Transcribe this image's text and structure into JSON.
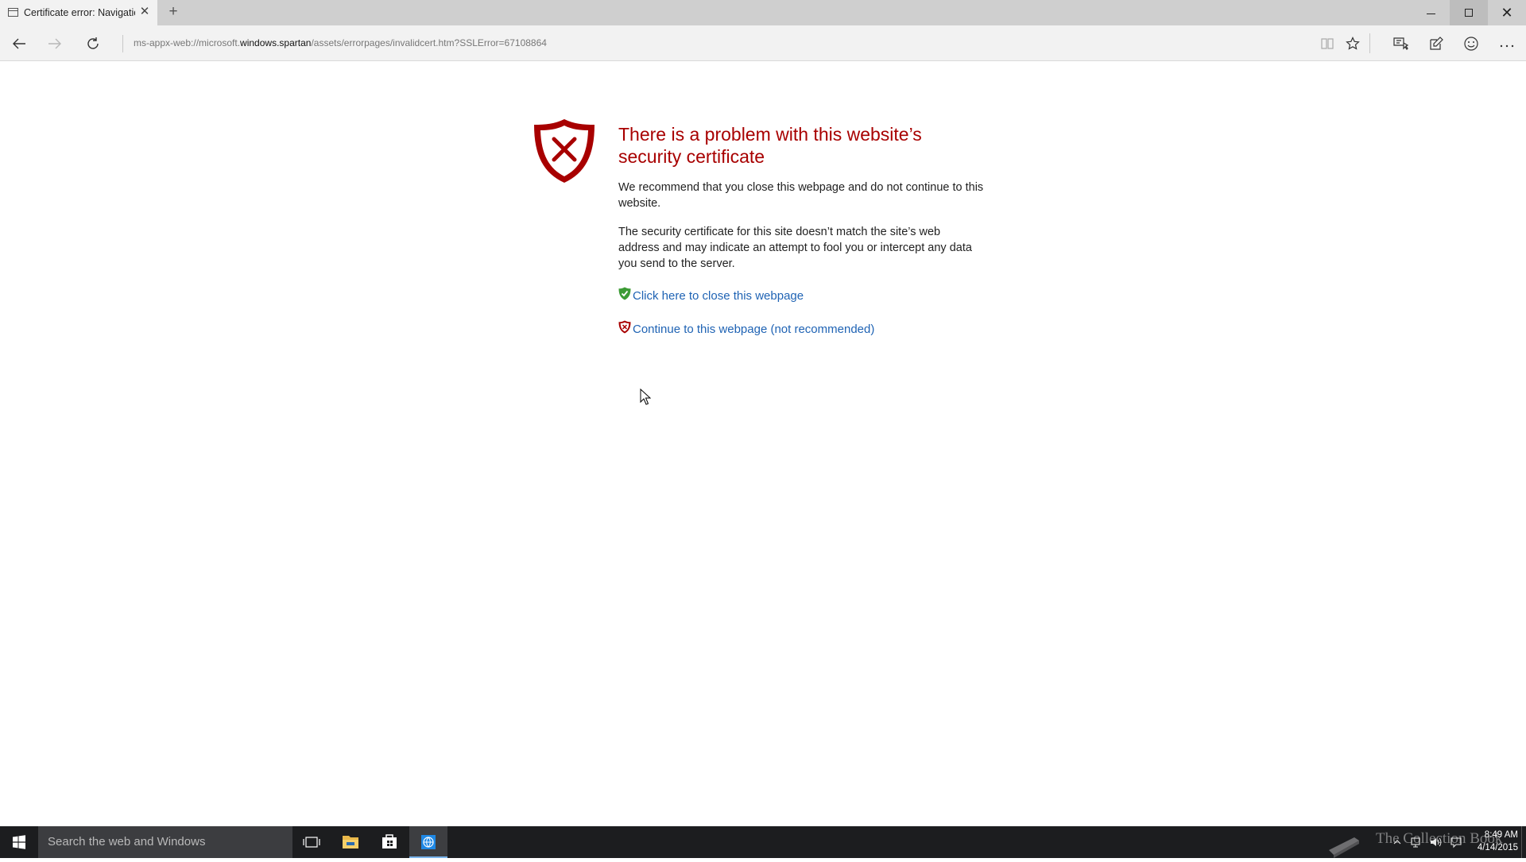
{
  "window": {
    "tab_title": "Certificate error: Navigatio",
    "tab_close_glyph": "✕",
    "new_tab_glyph": "+",
    "close_glyph": "✕"
  },
  "navbar": {
    "address_prefix": "ms-appx-web://microsoft.",
    "address_host": "windows.spartan",
    "address_suffix": "/assets/errorpages/invalidcert.htm?SSLError=67108864",
    "icons": [
      "back-icon",
      "forward-icon",
      "refresh-icon",
      "reading-view-icon",
      "favorite-star-icon",
      "hub-icon",
      "web-note-icon",
      "feedback-smiley-icon",
      "more-actions-icon"
    ]
  },
  "page": {
    "title": "There is a problem with this website’s security certificate",
    "recommend": "We recommend that you close this webpage and do not continue to this website.",
    "details": "The security certificate for this site doesn’t match the site’s web address and may indicate an attempt to fool you or intercept any data you send to the server.",
    "close_link": "Click here to close this webpage",
    "continue_link": "Continue to this webpage (not recommended)"
  },
  "taskbar": {
    "search_placeholder": "Search the web and Windows",
    "watermark_text": "The Collection Book",
    "time": "8:49 AM",
    "date": "4/14/2015"
  },
  "colors": {
    "error_red": "#a80000",
    "link_blue": "#1f63b4",
    "safe_green": "#3c9b35",
    "taskbar": "#1c1d1f"
  }
}
